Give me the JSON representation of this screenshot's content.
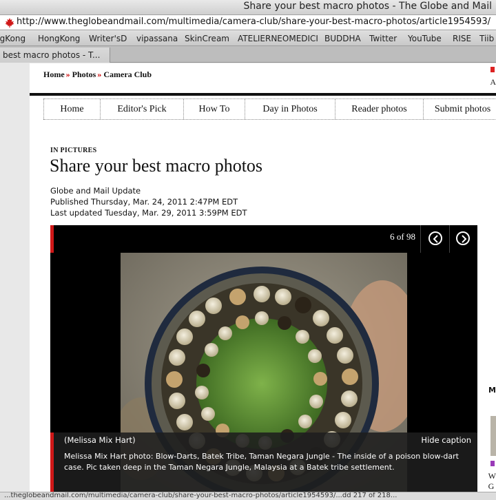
{
  "window": {
    "title": "Share your best macro photos - The Globe and Mail"
  },
  "urlbar": {
    "url": "http://www.theglobeandmail.com/multimedia/camera-club/share-your-best-macro-photos/article1954593/"
  },
  "bookmarks": [
    "ngKong",
    "HongKong",
    "Writer'sD",
    "vipassana",
    "SkinCream",
    "ATELIERNEOMEDICI",
    "BUDDHA",
    "Twitter",
    "YouTube",
    "RISE",
    "Tiib"
  ],
  "tab": {
    "label": "best macro photos - T..."
  },
  "breadcrumb": {
    "items": [
      "Home",
      "Photos",
      "Camera Club"
    ],
    "separator": "»"
  },
  "side_letter_a": "A",
  "nav": {
    "items": [
      "Home",
      "Editor's Pick",
      "How To",
      "Day in Photos",
      "Reader photos",
      "Submit photos"
    ]
  },
  "article": {
    "kicker": "IN PICTURES",
    "headline": "Share your best macro photos",
    "source": "Globe and Mail Update",
    "published": "Published Thursday, Mar. 24, 2011 2:47PM EDT",
    "updated": "Last updated Tuesday, Mar. 29, 2011 3:59PM EDT"
  },
  "gallery": {
    "counter": "6 of 98",
    "credit": "(Melissa Mix Hart)",
    "hide_caption": "Hide caption",
    "caption": "Melissa Mix Hart photo: Blow-Darts, Batek Tribe, Taman Negara Jungle - The inside of a poison blow-dart case. Pic taken deep in the Taman Negara Jungle, Malaysia at a Batek tribe settlement."
  },
  "sidebar": {
    "letter_m": "M",
    "letter_w": "W",
    "letter_g": "G"
  },
  "colors": {
    "accent_red": "#d01818",
    "nav_rule": "#111111",
    "gallery_bg": "#000000"
  },
  "status": {
    "text": "...theglobeandmail.com/multimedia/camera-club/share-your-best-macro-photos/article1954593/...dd 217 of 218..."
  }
}
